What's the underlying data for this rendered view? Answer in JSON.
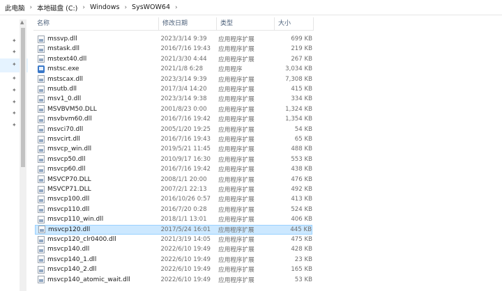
{
  "breadcrumb": [
    "此电脑",
    "本地磁盘 (C:)",
    "Windows",
    "SysWOW64"
  ],
  "columns": {
    "name": "名称",
    "date": "修改日期",
    "type": "类型",
    "size": "大小"
  },
  "files": [
    {
      "name": "mssvp.dll",
      "date": "2023/3/14 9:39",
      "type": "应用程序扩展",
      "size": "699 KB",
      "icon": "dll"
    },
    {
      "name": "mstask.dll",
      "date": "2016/7/16 19:43",
      "type": "应用程序扩展",
      "size": "219 KB",
      "icon": "dll"
    },
    {
      "name": "mstext40.dll",
      "date": "2021/3/30 4:44",
      "type": "应用程序扩展",
      "size": "267 KB",
      "icon": "dll"
    },
    {
      "name": "mstsc.exe",
      "date": "2021/1/8 6:28",
      "type": "应用程序",
      "size": "3,034 KB",
      "icon": "exe"
    },
    {
      "name": "mstscax.dll",
      "date": "2023/3/14 9:39",
      "type": "应用程序扩展",
      "size": "7,308 KB",
      "icon": "dll"
    },
    {
      "name": "msutb.dll",
      "date": "2017/3/4 14:20",
      "type": "应用程序扩展",
      "size": "415 KB",
      "icon": "dll"
    },
    {
      "name": "msv1_0.dll",
      "date": "2023/3/14 9:38",
      "type": "应用程序扩展",
      "size": "334 KB",
      "icon": "dll"
    },
    {
      "name": "MSVBVM50.DLL",
      "date": "2001/8/23 0:00",
      "type": "应用程序扩展",
      "size": "1,324 KB",
      "icon": "dll"
    },
    {
      "name": "msvbvm60.dll",
      "date": "2016/7/16 19:42",
      "type": "应用程序扩展",
      "size": "1,354 KB",
      "icon": "dll"
    },
    {
      "name": "msvci70.dll",
      "date": "2005/1/20 19:25",
      "type": "应用程序扩展",
      "size": "54 KB",
      "icon": "dll"
    },
    {
      "name": "msvcirt.dll",
      "date": "2016/7/16 19:43",
      "type": "应用程序扩展",
      "size": "65 KB",
      "icon": "dll"
    },
    {
      "name": "msvcp_win.dll",
      "date": "2019/5/21 11:45",
      "type": "应用程序扩展",
      "size": "488 KB",
      "icon": "dll"
    },
    {
      "name": "msvcp50.dll",
      "date": "2010/9/17 16:30",
      "type": "应用程序扩展",
      "size": "553 KB",
      "icon": "dll"
    },
    {
      "name": "msvcp60.dll",
      "date": "2016/7/16 19:42",
      "type": "应用程序扩展",
      "size": "438 KB",
      "icon": "dll"
    },
    {
      "name": "MSVCP70.DLL",
      "date": "2008/1/1 20:00",
      "type": "应用程序扩展",
      "size": "476 KB",
      "icon": "dll"
    },
    {
      "name": "MSVCP71.DLL",
      "date": "2007/2/1 22:13",
      "type": "应用程序扩展",
      "size": "492 KB",
      "icon": "dll"
    },
    {
      "name": "msvcp100.dll",
      "date": "2016/10/26 0:57",
      "type": "应用程序扩展",
      "size": "413 KB",
      "icon": "dll"
    },
    {
      "name": "msvcp110.dll",
      "date": "2016/7/20 0:28",
      "type": "应用程序扩展",
      "size": "524 KB",
      "icon": "dll"
    },
    {
      "name": "msvcp110_win.dll",
      "date": "2018/1/1 13:01",
      "type": "应用程序扩展",
      "size": "406 KB",
      "icon": "dll"
    },
    {
      "name": "msvcp120.dll",
      "date": "2017/5/24 16:01",
      "type": "应用程序扩展",
      "size": "445 KB",
      "icon": "dll",
      "selected": true
    },
    {
      "name": "msvcp120_clr0400.dll",
      "date": "2021/3/19 14:05",
      "type": "应用程序扩展",
      "size": "475 KB",
      "icon": "dll"
    },
    {
      "name": "msvcp140.dll",
      "date": "2022/6/10 19:49",
      "type": "应用程序扩展",
      "size": "428 KB",
      "icon": "dll"
    },
    {
      "name": "msvcp140_1.dll",
      "date": "2022/6/10 19:49",
      "type": "应用程序扩展",
      "size": "23 KB",
      "icon": "dll"
    },
    {
      "name": "msvcp140_2.dll",
      "date": "2022/6/10 19:49",
      "type": "应用程序扩展",
      "size": "165 KB",
      "icon": "dll"
    },
    {
      "name": "msvcp140_atomic_wait.dll",
      "date": "2022/6/10 19:49",
      "type": "应用程序扩展",
      "size": "53 KB",
      "icon": "dll"
    }
  ],
  "colors": {
    "selection": "#cce8ff",
    "selection_border": "#99d1ff",
    "header_text": "#4c607a"
  }
}
